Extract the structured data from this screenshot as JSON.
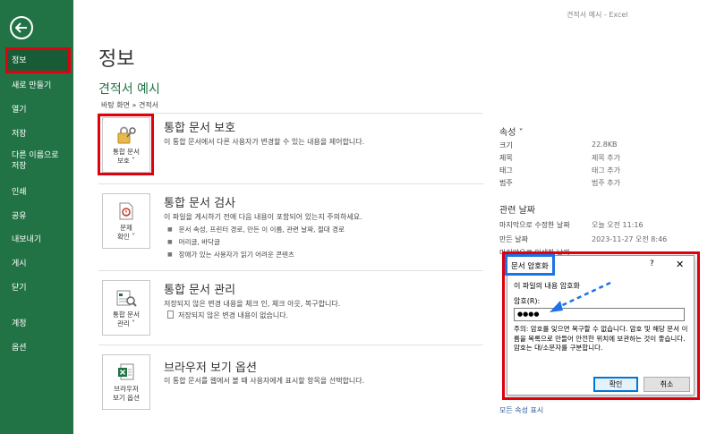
{
  "window_title": "견적서 예시 - Excel",
  "sidebar": {
    "back_label": "뒤로",
    "items": [
      {
        "label": "정보"
      },
      {
        "label": "새로 만들기"
      },
      {
        "label": "열기"
      },
      {
        "label": "저장"
      },
      {
        "label": "다른 이름으로 저장"
      },
      {
        "label": "인쇄"
      },
      {
        "label": "공유"
      },
      {
        "label": "내보내기"
      },
      {
        "label": "게시"
      },
      {
        "label": "닫기"
      },
      {
        "label": "계정"
      },
      {
        "label": "옵션"
      }
    ]
  },
  "main": {
    "page_title": "정보",
    "doc_title": "견적서 예시",
    "breadcrumb": "바탕 화면 » 견적서",
    "sections": [
      {
        "tile_line1": "통합 문서",
        "tile_line2": "보호 ˅",
        "title": "통합 문서 보호",
        "desc": "이 통합 문서에서 다른 사용자가 변경할 수 있는 내용을 제어합니다."
      },
      {
        "tile_line1": "문제",
        "tile_line2": "확인 ˅",
        "title": "통합 문서 검사",
        "desc": "이 파일을 게시하기 전에 다음 내용이 포함되어 있는지 주의하세요.",
        "bullets": [
          "문서 속성, 프린터 경로, 만든 이 이름, 관련 날짜, 절대 경로",
          "머리글, 바닥글",
          "장애가 있는 사용자가 읽기 어려운 콘텐츠"
        ]
      },
      {
        "tile_line1": "통합 문서",
        "tile_line2": "관리 ˅",
        "title": "통합 문서 관리",
        "desc": "저장되지 않은 변경 내용을 체크 인, 체크 아웃, 복구합니다.",
        "desc2": "저장되지 않은 변경 내용이 없습니다."
      },
      {
        "tile_line1": "브라우저",
        "tile_line2": "보기 옵션",
        "title": "브라우저 보기 옵션",
        "desc": "이 통합 문서를 웹에서 볼 때 사용자에게 표시할 항목을 선택합니다."
      }
    ]
  },
  "properties": {
    "heading": "속성 ˅",
    "rows": [
      {
        "key": "크기",
        "value": "22.8KB"
      },
      {
        "key": "제목",
        "value": "제목 추가"
      },
      {
        "key": "태그",
        "value": "태그 추가"
      },
      {
        "key": "범주",
        "value": "범주 추가"
      }
    ],
    "dates_heading": "관련 날짜",
    "date_rows": [
      {
        "key": "마지막으로 수정한 날짜",
        "value": "오늘 오전 11:16"
      },
      {
        "key": "만든 날짜",
        "value": "2023-11-27 오전 8:46"
      },
      {
        "key": "마지막으로 인쇄한 날짜",
        "value": ""
      }
    ],
    "show_all": "모든 속성 표시"
  },
  "dialog": {
    "title": "문서 암호화",
    "help": "?",
    "close": "✕",
    "subtitle": "이 파일의 내용 암호화",
    "label": "암호(R):",
    "password_value": "●●●●",
    "note": "주의: 암호를 잊으면 복구할 수 없습니다. 암호 및 해당 문서 이름을 목록으로 만들어 안전한 위치에 보관하는 것이 좋습니다. 암호는 대/소문자를 구분합니다.",
    "ok_label": "확인",
    "cancel_label": "취소"
  },
  "colors": {
    "excel_green": "#217346",
    "highlight_red": "#e0000e",
    "highlight_blue": "#1a73e8"
  }
}
